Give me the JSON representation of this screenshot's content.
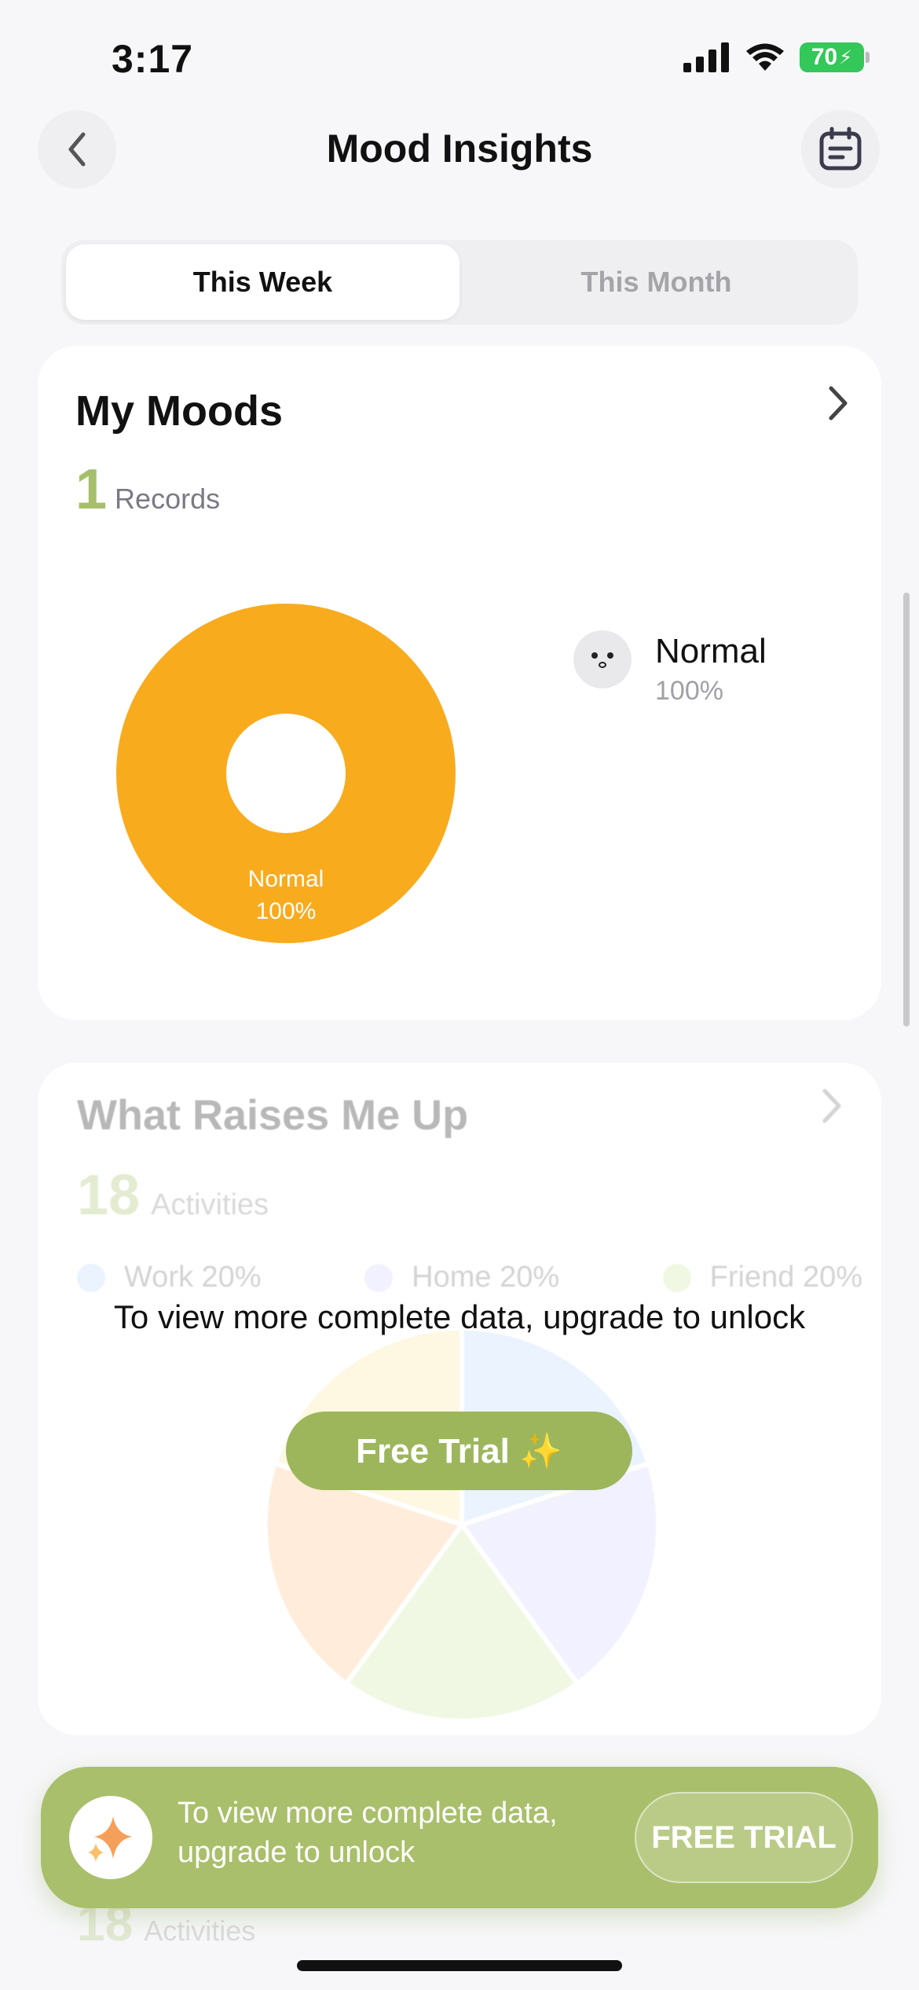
{
  "status_bar": {
    "time": "3:17",
    "battery": "70"
  },
  "header": {
    "title": "Mood Insights"
  },
  "segment": {
    "tabs": [
      "This Week",
      "This Month"
    ],
    "selected": "This Week"
  },
  "my_moods": {
    "title": "My Moods",
    "count": "1",
    "count_label": "Records",
    "chart_data": {
      "type": "pie",
      "categories": [
        "Normal"
      ],
      "values": [
        100
      ],
      "slice_label": "Normal",
      "slice_percent": "100%",
      "colors": [
        "#f9ab1e"
      ]
    },
    "legend": [
      {
        "name": "Normal",
        "percent": "100%"
      }
    ]
  },
  "raises_me_up": {
    "title": "What Raises Me Up",
    "count": "18",
    "count_label": "Activities",
    "legend": [
      {
        "name": "Work 20%",
        "color": "#bcd9ff"
      },
      {
        "name": "Home 20%",
        "color": "#d6d4ff"
      },
      {
        "name": "Friend 20%",
        "color": "#cfeaa8"
      }
    ],
    "lock_message": "To view more complete data, upgrade to unlock",
    "trial_button": "Free Trial ✨"
  },
  "banner": {
    "text": "To view more complete data, upgrade to unlock",
    "button": "FREE TRIAL"
  },
  "peek": {
    "count": "18",
    "label": "Activities"
  },
  "colors": {
    "accent": "#9db65c",
    "mood_orange": "#f9ab1e"
  }
}
